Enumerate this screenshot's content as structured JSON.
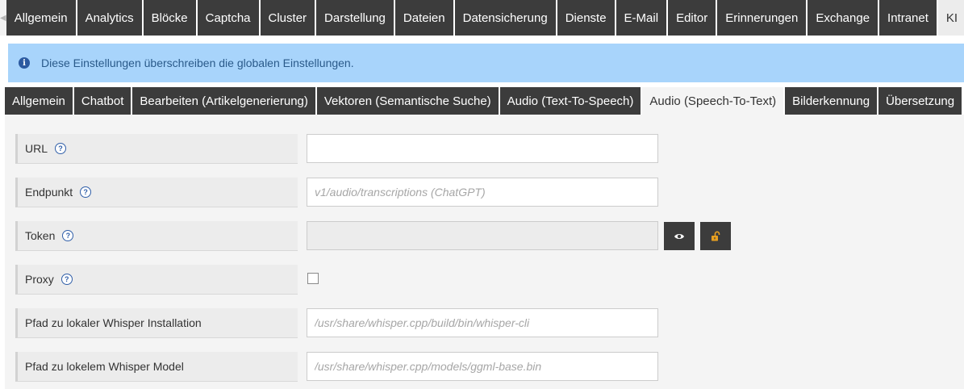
{
  "top_tabs": {
    "scroll_left": "◀",
    "items": [
      "Allgemein",
      "Analytics",
      "Blöcke",
      "Captcha",
      "Cluster",
      "Darstellung",
      "Dateien",
      "Datensicherung",
      "Dienste",
      "E-Mail",
      "Editor",
      "Erinnerungen",
      "Exchange",
      "Intranet",
      "KI"
    ],
    "active": "KI"
  },
  "banner": {
    "icon": "info-icon",
    "icon_glyph": "i",
    "text": "Diese Einstellungen überschreiben die globalen Einstellungen."
  },
  "sub_tabs": {
    "items": [
      "Allgemein",
      "Chatbot",
      "Bearbeiten (Artikelgenerierung)",
      "Vektoren (Semantische Suche)",
      "Audio (Text-To-Speech)",
      "Audio (Speech-To-Text)",
      "Bilderkennung",
      "Übersetzung"
    ],
    "active": "Audio (Speech-To-Text)"
  },
  "help_glyph": "?",
  "form": {
    "url": {
      "label": "URL",
      "value": "",
      "placeholder": ""
    },
    "endpoint": {
      "label": "Endpunkt",
      "value": "",
      "placeholder": "v1/audio/transcriptions (ChatGPT)"
    },
    "token": {
      "label": "Token",
      "value": "",
      "placeholder": ""
    },
    "proxy": {
      "label": "Proxy",
      "checked": false
    },
    "whisper_path": {
      "label": "Pfad zu lokaler Whisper Installation",
      "value": "",
      "placeholder": "/usr/share/whisper.cpp/build/bin/whisper-cli"
    },
    "whisper_model": {
      "label": "Pfad zu lokelem Whisper Model",
      "value": "",
      "placeholder": "/usr/share/whisper.cpp/models/ggml-base.bin"
    }
  },
  "colors": {
    "tab_bg": "#3c3c3c",
    "banner_bg": "#a8d4fb",
    "unlock_icon": "#e8a020"
  }
}
